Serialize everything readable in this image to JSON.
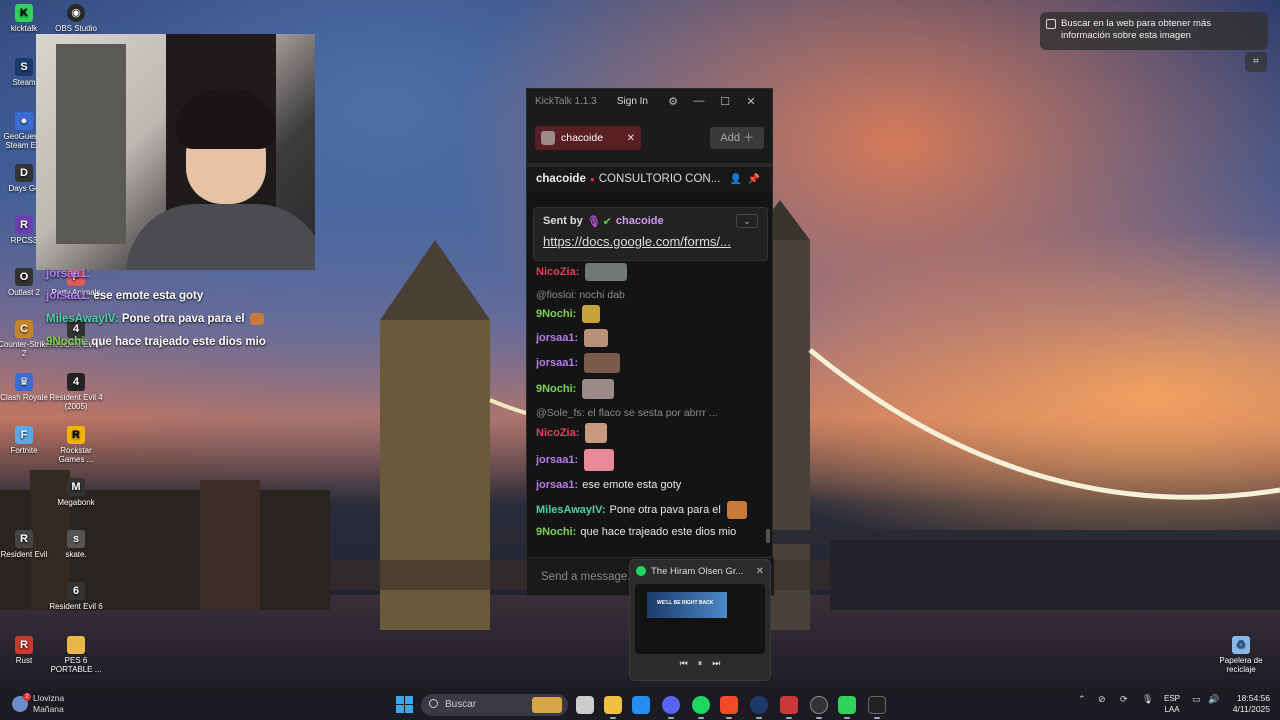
{
  "desktop": {
    "icons": [
      {
        "label": "kicktalk",
        "icon": "kicktalk-icon",
        "color": "#2fd35a"
      },
      {
        "label": "OBS Studio",
        "icon": "obs-icon",
        "color": "#2a2a2a"
      },
      {
        "label": "Steam",
        "icon": "steam-icon",
        "color": "#1b3a6b"
      },
      {
        "label": "GeoGuessr Steam E...",
        "icon": "geoguessr-icon",
        "color": "#3a6cd3"
      },
      {
        "label": "Days Go",
        "icon": "daysgone-icon",
        "color": "#333333"
      },
      {
        "label": "RPCS3",
        "icon": "rpcs3-icon",
        "color": "#6a3fb0"
      },
      {
        "label": "Outlast 2",
        "icon": "outlast-icon",
        "color": "#333333"
      },
      {
        "label": "Party Animals",
        "icon": "partyanimals-icon",
        "color": "#e05c5c"
      },
      {
        "label": "Counter-Strike 2",
        "icon": "cs2-icon",
        "color": "#c4842a"
      },
      {
        "label": "Resident Evil 4",
        "icon": "re4-icon",
        "color": "#333333"
      },
      {
        "label": "Clash Royale",
        "icon": "clashroyale-icon",
        "color": "#3a6cd3"
      },
      {
        "label": "Resident Evil 4 (2005)",
        "icon": "re4-2005-icon",
        "color": "#222222"
      },
      {
        "label": "Fortnite",
        "icon": "fortnite-icon",
        "color": "#5aa8e8"
      },
      {
        "label": "Rockstar Games ...",
        "icon": "rockstar-icon",
        "color": "#f0b400"
      },
      {
        "label": "Megabonk",
        "icon": "megabonk-icon",
        "color": "#333333"
      },
      {
        "label": "Resident Evil",
        "icon": "re-icon",
        "color": "#444444"
      },
      {
        "label": "skate.",
        "icon": "skate-icon",
        "color": "#555555"
      },
      {
        "label": "Resident Evil 6",
        "icon": "re6-icon",
        "color": "#333333"
      },
      {
        "label": "Rust",
        "icon": "rust-icon",
        "color": "#c83a2a"
      },
      {
        "label": "PES 6 PORTABLE ...",
        "icon": "folder-icon",
        "color": "#e8b84a"
      },
      {
        "label": "Papelera de reciclaje",
        "icon": "recycle-bin-icon",
        "color": "#8ab8e8"
      }
    ]
  },
  "overlay_chat": [
    {
      "user": "jorsaa1:",
      "text": "",
      "user_color": "#b77af0"
    },
    {
      "user": "jorsaa1:",
      "text": "ese emote esta goty",
      "user_color": "#b77af0"
    },
    {
      "user": "MilesAwayIV:",
      "text": "Pone otra pava para el",
      "user_color": "#4fd1a5"
    },
    {
      "user": "9Nochi:",
      "text": "que hace trajeado este dios mio",
      "user_color": "#7cd34f"
    }
  ],
  "kicktalk": {
    "title": "KickTalk 1.1.3",
    "sign_in": "Sign In",
    "tab_name": "chacoide",
    "add_label": "Add",
    "channel": "chacoide",
    "stream_title": "CONSULTORIO CON...",
    "pinned": {
      "sent_by": "Sent by",
      "channel": "chacoide",
      "link": "https://docs.google.com/forms/..."
    },
    "messages": [
      {
        "kind": "msg",
        "user": "NicoZia:",
        "text": "",
        "user_color": "#e0435a",
        "emote": "#6d7a78"
      },
      {
        "kind": "reply",
        "text": "@fiosloi: nochi dab"
      },
      {
        "kind": "msg",
        "user": "9Nochi:",
        "text": "",
        "user_color": "#7cd34f",
        "emote": "#c8a23a"
      },
      {
        "kind": "msg",
        "user": "jorsaa1:",
        "text": "",
        "user_color": "#b77af0",
        "emote": "#b89078"
      },
      {
        "kind": "msg",
        "user": "jorsaa1:",
        "text": "",
        "user_color": "#b77af0",
        "emote": "#7a5a4a"
      },
      {
        "kind": "msg",
        "user": "9Nochi:",
        "text": "",
        "user_color": "#7cd34f",
        "emote": "#9a8a88"
      },
      {
        "kind": "reply",
        "text": "@Sole_fs: el flaco se sesta por abrrr ..."
      },
      {
        "kind": "msg",
        "user": "NicoZia:",
        "text": "",
        "user_color": "#e0435a",
        "emote": "#c89a80"
      },
      {
        "kind": "msg",
        "user": "jorsaa1:",
        "text": "",
        "user_color": "#b77af0",
        "emote": "#e88a9a"
      },
      {
        "kind": "msg",
        "user": "jorsaa1:",
        "text": "ese emote esta goty",
        "user_color": "#b77af0",
        "emote": ""
      },
      {
        "kind": "msg",
        "user": "MilesAwayIV:",
        "text": "Pone otra pava para el",
        "user_color": "#4fd1a5",
        "emote": "#c87a3a"
      },
      {
        "kind": "msg",
        "user": "9Nochi:",
        "text": "que hace trajeado este dios mio",
        "user_color": "#7cd34f",
        "emote": ""
      }
    ],
    "input_placeholder": "Send a message..."
  },
  "media": {
    "title": "The Hiram Olsen Gr...",
    "thumb_text": "WE'LL BE RIGHT BACK"
  },
  "search_tip": {
    "text": "Buscar en la web para obtener más información sobre esta imagen"
  },
  "taskbar": {
    "weather_main": "Llovizna",
    "weather_sub": "Mañana",
    "weather_badge": "2",
    "search_label": "Buscar",
    "lang_top": "ESP",
    "lang_bottom": "LAA",
    "time": "18:54:56",
    "date": "4/11/2025",
    "apps": [
      {
        "icon": "file-explorer-icon",
        "color": "#e8c24a"
      },
      {
        "icon": "task-view-icon",
        "color": "#cccccc"
      },
      {
        "icon": "folder-icon",
        "color": "#f0c040"
      },
      {
        "icon": "bing-icon",
        "color": "#2a8cf0"
      },
      {
        "icon": "discord-icon",
        "color": "#5865f2"
      },
      {
        "icon": "spotify-icon",
        "color": "#1ed760"
      },
      {
        "icon": "brave-icon",
        "color": "#f04a2a"
      },
      {
        "icon": "steam-icon",
        "color": "#1b3a6b"
      },
      {
        "icon": "voicemeeter-icon",
        "color": "#c83a3a"
      },
      {
        "icon": "obs-icon",
        "color": "#333333"
      },
      {
        "icon": "kicktalk-icon",
        "color": "#2fd35a"
      },
      {
        "icon": "epic-games-icon",
        "color": "#222222"
      }
    ]
  }
}
